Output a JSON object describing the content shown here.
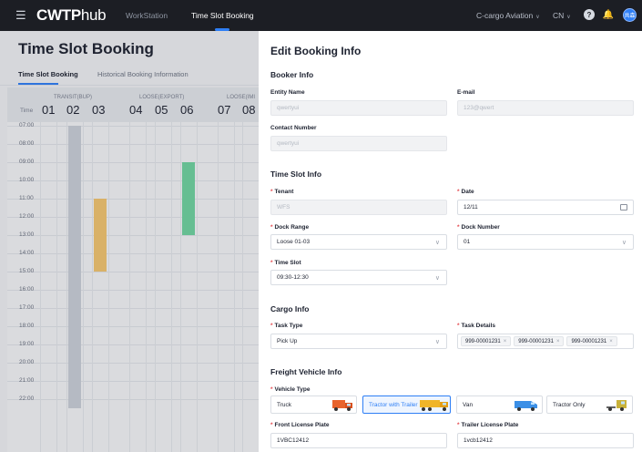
{
  "topbar": {
    "menu_icon": "menu-icon",
    "logo_c": "C",
    "logo_wtp": "WTP",
    "logo_hub": "hub",
    "nav": [
      "WorkStation",
      "Time Slot Booking"
    ],
    "company": "C-cargo Aviation",
    "language": "CN",
    "help_icon": "help-icon",
    "help_glyph": "?",
    "bell_icon": "bell-icon",
    "avatar": "共森"
  },
  "left": {
    "title": "Time Slot Booking",
    "tabs": [
      "Time Slot Booking",
      "Historical Booking Information"
    ],
    "time_caption": "Time",
    "groups": [
      "TRANSIT(BUP)",
      "LOOSE(EXPORT)",
      "LOOSE(IMI"
    ],
    "columns": [
      "01",
      "02",
      "03",
      "04",
      "05",
      "06",
      "07",
      "08"
    ],
    "times": [
      "07:00",
      "08:00",
      "09:00",
      "10:00",
      "11:00",
      "12:00",
      "13:00",
      "14:00",
      "15:00",
      "16:00",
      "17:00",
      "18:00",
      "19:00",
      "20:00",
      "21:00",
      "22:00"
    ],
    "bookings": [
      {
        "column": "02",
        "start": "07:00",
        "end": "22:30",
        "color": "#c9ced8"
      },
      {
        "column": "03",
        "start": "11:00",
        "end": "15:00",
        "color": "#f2c46f"
      },
      {
        "column": "06",
        "start": "09:00",
        "end": "13:00",
        "color": "#6fd3a0"
      }
    ]
  },
  "panel": {
    "title": "Edit Booking Info",
    "booker_section": "Booker Info",
    "entity_label": "Entity Name",
    "entity_value": "qwertyui",
    "email_label": "E-mail",
    "email_value": "123@qwert",
    "contact_label": "Contact Number",
    "contact_value": "qwertyui",
    "slot_section": "Time Slot Info",
    "tenant_label": "Tenant",
    "tenant_value": "WFS",
    "date_label": "Date",
    "date_value": "12/11",
    "dock_range_label": "Dock Range",
    "dock_range_value": "Loose 01-03",
    "dock_number_label": "Dock  Number",
    "dock_number_value": "01",
    "time_slot_label": "Time Slot",
    "time_slot_value": "09:30-12:30",
    "cargo_section": "Cargo Info",
    "task_type_label": "Task Type",
    "task_type_value": "Pick Up",
    "task_details_label": "Task Details",
    "task_details": [
      "999-00001231",
      "999-00001231",
      "999-00001231"
    ],
    "freight_section": "Freight Vehicle Info",
    "vehicle_type_label": "Vehicle Type",
    "vehicle_types": [
      "Truck",
      "Tractor with Trailer",
      "Van",
      "Tractor Only"
    ],
    "vehicle_selected": "Tractor with Trailer",
    "front_plate_label": "Front License Plate",
    "front_plate_value": "1VBC12412",
    "trailer_plate_label": "Trailer License Plate",
    "trailer_plate_value": "1vcb12412"
  },
  "colors": {
    "accent": "#2f7ff5",
    "topbar": "#1c1e24",
    "required": "#e5484d"
  }
}
